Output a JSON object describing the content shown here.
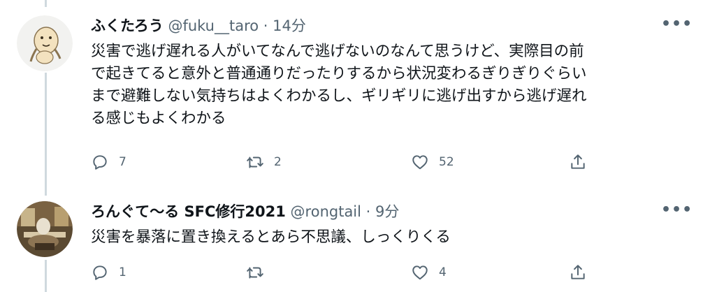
{
  "tweets": [
    {
      "name": "ふくたろう",
      "handle": "@fuku__taro",
      "separator": "·",
      "time": "14分",
      "more": "•••",
      "text": "災害で逃げ遅れる人がいてなんで逃げないのなんて思うけど、実際目の前\nで起きてると意外と普通通りだったりするから状況変わるぎりぎりぐらい\nまで避難しない気持ちはよくわかるし、ギリギリに逃げ出すから逃げ遅れ\nる感じもよくわかる",
      "replies": "7",
      "retweets": "2",
      "likes": "52"
    },
    {
      "name": "ろんぐて〜る SFC修行2021",
      "handle": "@rongtail",
      "separator": "·",
      "time": "9分",
      "more": "•••",
      "text": "災害を暴落に置き換えるとあら不思議、しっくりくる",
      "replies": "1",
      "retweets": "",
      "likes": "4"
    }
  ],
  "icons": [
    "reply-icon",
    "retweet-icon",
    "like-icon",
    "share-icon",
    "more-icon"
  ],
  "colors": {
    "text": "#0f1419",
    "secondary": "#536471",
    "thread_line": "#cfd9de"
  }
}
